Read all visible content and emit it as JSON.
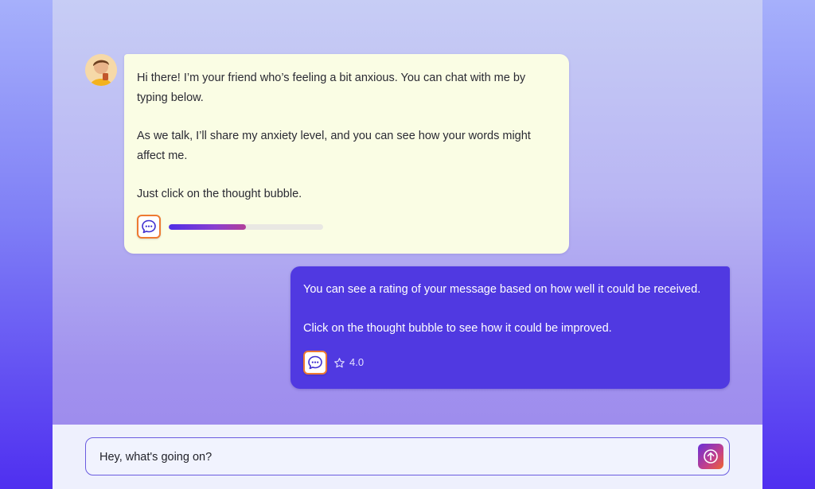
{
  "colors": {
    "user_bubble": "#5039e1",
    "bot_bubble": "#fafde4",
    "thought_button_border": "#ee7a32"
  },
  "bot_message": {
    "avatar_icon": "avatar-person-icon",
    "paragraphs": [
      "Hi there! I’m your friend who’s feeling a bit anxious. You can chat with me by typing below.",
      "As we talk, I’ll share my anxiety level, and you can see how your words might affect me.",
      "Just click on the thought bubble."
    ],
    "thought_icon": "speech-bubble-icon",
    "anxiety_level": 0.5
  },
  "user_message": {
    "paragraphs": [
      "You can see a rating of your message based on how well it could be received.",
      "Click on the thought bubble to see how it could be improved."
    ],
    "thought_icon": "speech-bubble-icon",
    "rating_icon": "star-outline-icon",
    "rating": "4.0"
  },
  "composer": {
    "value": "Hey, what's going on?",
    "placeholder": "",
    "send_icon": "arrow-up-circle-icon"
  }
}
